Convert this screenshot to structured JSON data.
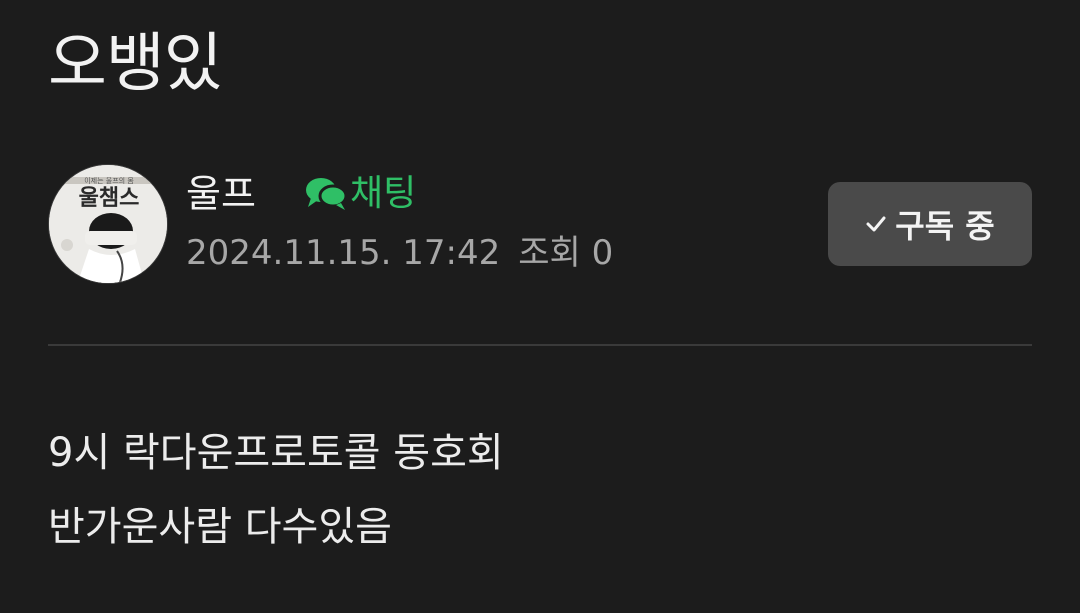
{
  "post": {
    "title": "오뱅있",
    "author": "울프",
    "chat_label": "채팅",
    "date": "2024.11.15. 17:42",
    "views": "조회 0",
    "subscribe_label": "구독 중",
    "body_lines": [
      "9시 락다운프로토콜 동호회",
      "반가운사람 다수있음"
    ]
  },
  "avatar": {
    "banner_text": "울챔스",
    "small_text": "이제는 울프의 몸"
  },
  "icons": {
    "chat": "chat-bubbles-icon",
    "check": "check-icon"
  },
  "colors": {
    "background": "#1c1c1c",
    "chat_accent": "#2fbf66",
    "button_bg": "#4a4a4a",
    "meta_text": "#a7a7a7"
  }
}
